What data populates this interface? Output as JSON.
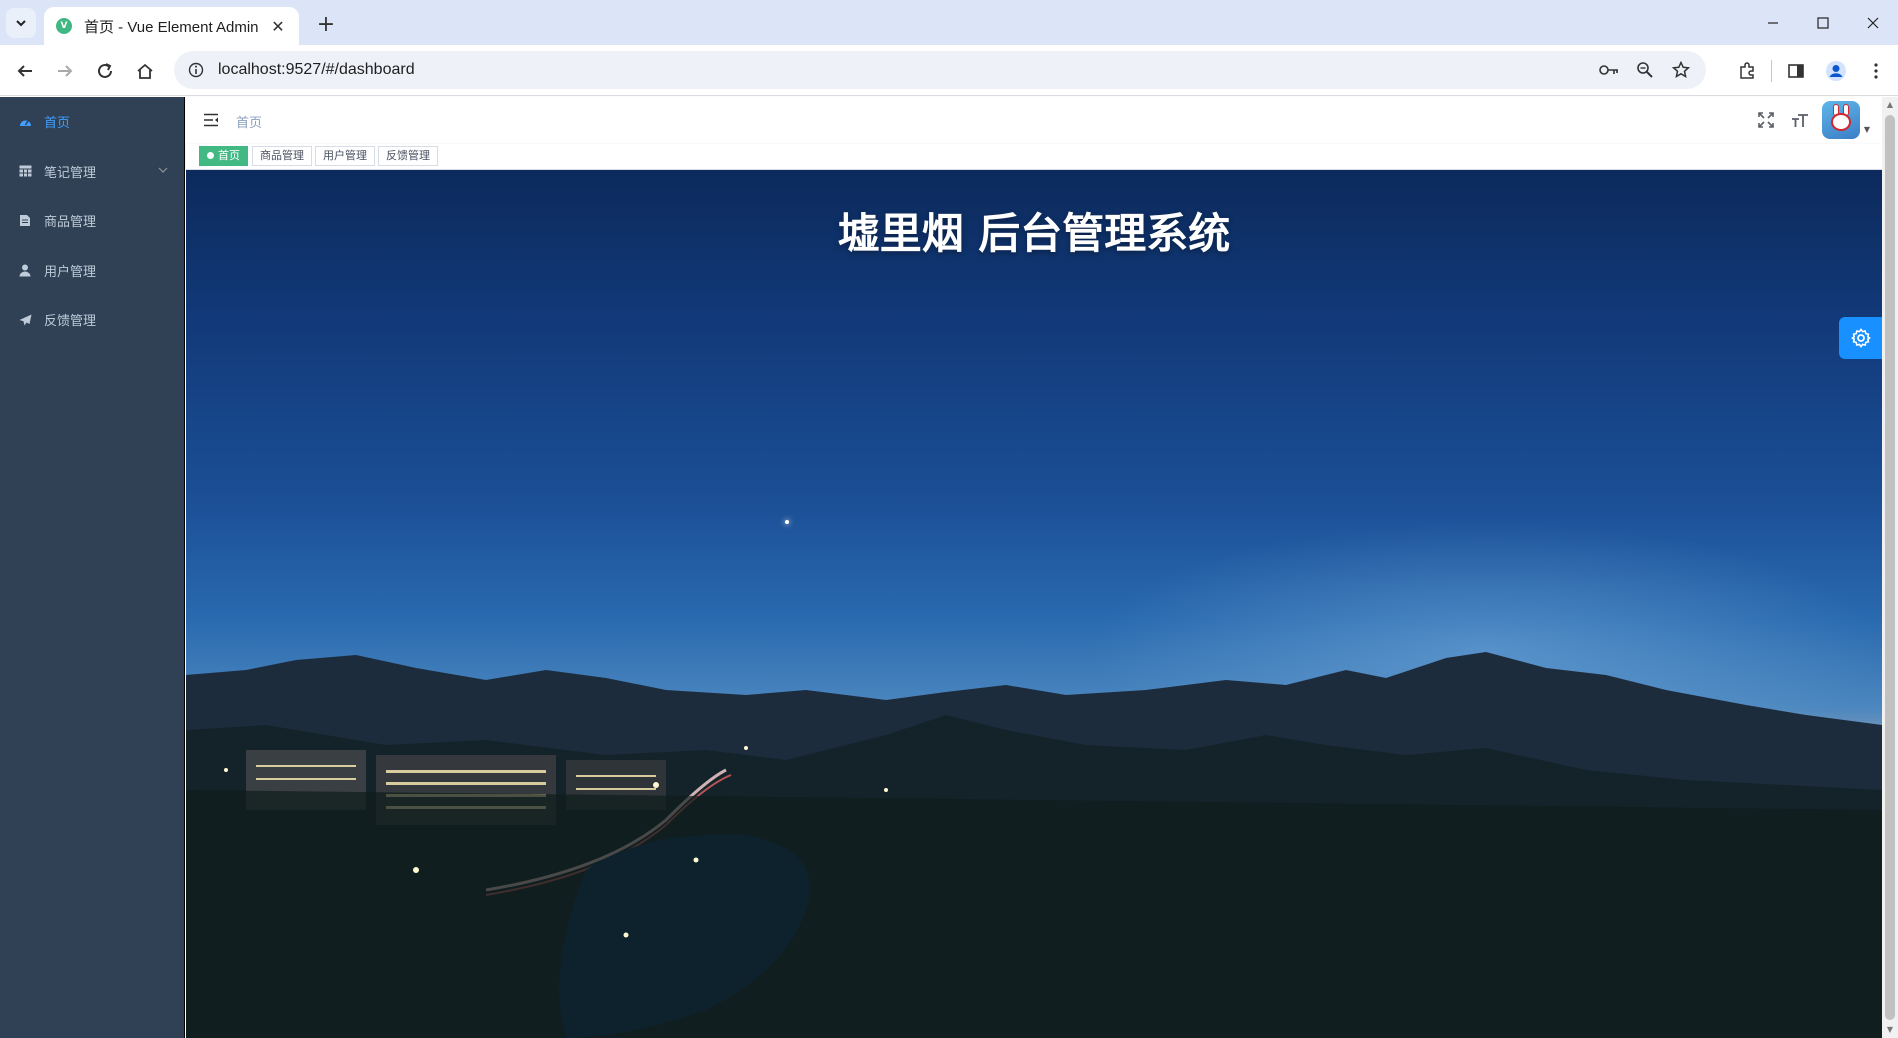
{
  "browser": {
    "tab_title": "首页 - Vue Element Admin",
    "favicon_letter": "V",
    "url": "localhost:9527/#/dashboard"
  },
  "sidebar": {
    "items": [
      {
        "label": "首页",
        "icon": "dashboard-icon",
        "active": true
      },
      {
        "label": "笔记管理",
        "icon": "table-icon",
        "has_submenu": true
      },
      {
        "label": "商品管理",
        "icon": "document-icon"
      },
      {
        "label": "用户管理",
        "icon": "user-icon"
      },
      {
        "label": "反馈管理",
        "icon": "send-icon"
      }
    ]
  },
  "navbar": {
    "breadcrumb": "首页"
  },
  "tags": [
    {
      "label": "首页",
      "active": true
    },
    {
      "label": "商品管理"
    },
    {
      "label": "用户管理"
    },
    {
      "label": "反馈管理"
    }
  ],
  "dashboard": {
    "title": "墟里烟 后台管理系统"
  },
  "colors": {
    "sidebar_bg": "#304156",
    "menu_text": "#bfcbd9",
    "menu_active": "#409eff",
    "tag_active": "#42b983",
    "settings_btn": "#1890ff"
  }
}
